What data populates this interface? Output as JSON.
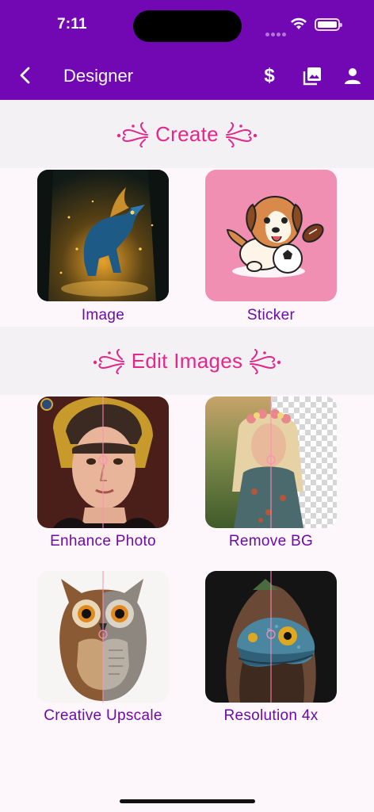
{
  "status_bar": {
    "time": "7:11"
  },
  "app_bar": {
    "title": "Designer",
    "back_icon": "chevron-left-icon",
    "actions": [
      {
        "name": "dollar-icon",
        "glyph": "$"
      },
      {
        "name": "gallery-icon"
      },
      {
        "name": "account-icon"
      }
    ]
  },
  "sections": [
    {
      "title": "Create",
      "items": [
        {
          "label": "Image",
          "thumbnail": "fantasy-creature-artwork"
        },
        {
          "label": "Sticker",
          "thumbnail": "puppy-soccer-sticker"
        }
      ]
    },
    {
      "title": "Edit Images",
      "items": [
        {
          "label": "Enhance Photo",
          "thumbnail": "portrait-before-after"
        },
        {
          "label": "Remove BG",
          "thumbnail": "woman-flower-crown-transparent"
        },
        {
          "label": "Creative Upscale",
          "thumbnail": "owl-before-after"
        },
        {
          "label": "Resolution 4x",
          "thumbnail": "lizard-hood-before-after"
        }
      ]
    }
  ],
  "colors": {
    "primary": "#7207b4",
    "accent_pink": "#e3278b",
    "label_purple": "#6e0ba8",
    "section_bg": "#f3f1f3",
    "page_bg": "#fdf6fb"
  }
}
